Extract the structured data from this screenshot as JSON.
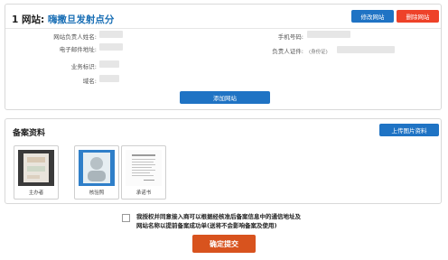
{
  "site": {
    "title_prefix": "1 网站:",
    "title_name": "嗨撒旦发射点分",
    "modify_button": "修改网站",
    "delete_button": "删除网站",
    "fields": {
      "owner_name_label": "网站负责人姓名:",
      "phone_label": "手机号码:",
      "email_label": "电子邮件地址:",
      "id_label": "负责人证件:",
      "id_hint": "(身份证)",
      "business_label": "业务标识:",
      "domain_label": "域名:"
    },
    "add_button": "添加网站"
  },
  "record": {
    "title": "备案资料",
    "upload_button": "上传图片资料",
    "thumbnails": [
      {
        "caption": "主办者"
      },
      {
        "caption": "核验照"
      },
      {
        "caption": "承诺书"
      }
    ]
  },
  "agreement": {
    "line1": "我授权并同意接入商可以根据经核准后备案信息中的通信地址及",
    "line2": "网站名称以提前备案成功单(送将不会影响备案及使用)"
  },
  "submit_button": "确定提交",
  "colors": {
    "accent_blue": "#1f73c4",
    "danger_red": "#ee4229",
    "submit_orange": "#d8531e",
    "title_blue": "#1a6fb5"
  }
}
